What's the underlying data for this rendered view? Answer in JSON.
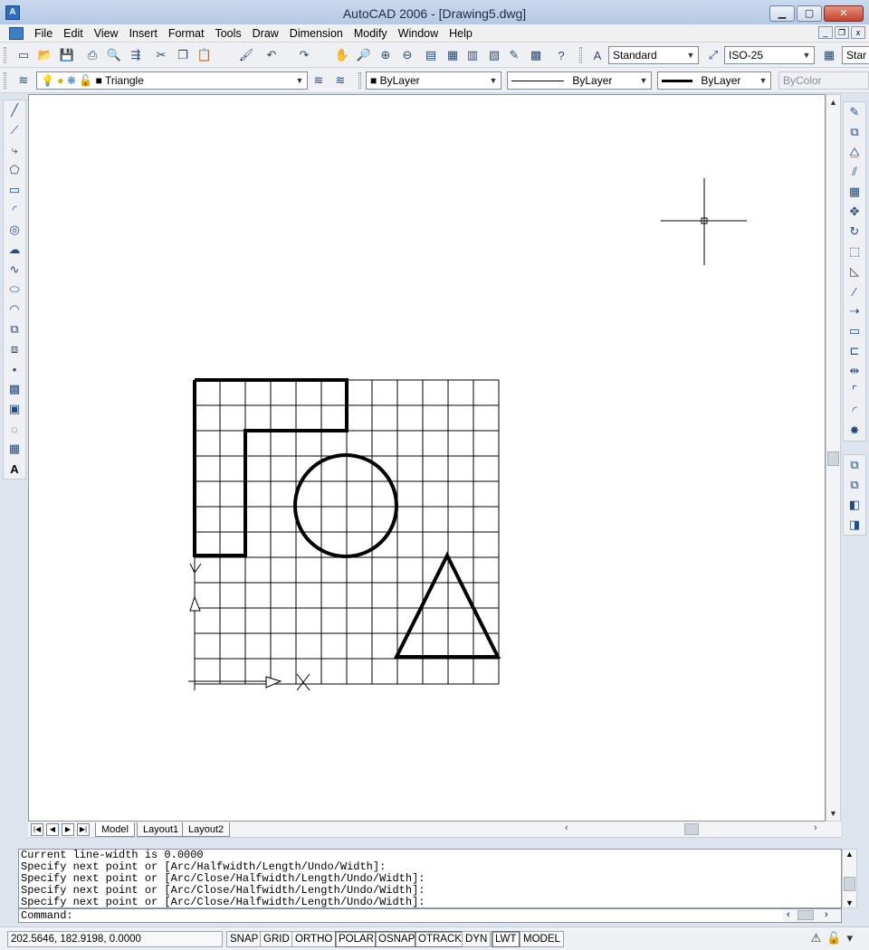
{
  "window": {
    "title": "AutoCAD 2006 - [Drawing5.dwg]",
    "app_icon": "A",
    "minimize": "▁",
    "maximize": "▢",
    "close": "✕"
  },
  "menu": {
    "items": [
      "File",
      "Edit",
      "View",
      "Insert",
      "Format",
      "Tools",
      "Draw",
      "Dimension",
      "Modify",
      "Window",
      "Help"
    ],
    "mdi_min": "_",
    "mdi_restore": "❐",
    "mdi_close": "x"
  },
  "toolbar": {
    "text_style": "Standard",
    "dim_style": "ISO-25",
    "table_style_partial": "Star",
    "layer": "Triangle",
    "color": "ByLayer",
    "linetype": "ByLayer",
    "lineweight": "ByLayer",
    "plot_style": "ByColor"
  },
  "ucs": {
    "x_label": "X",
    "y_label": "Y"
  },
  "tabs": [
    "Model",
    "Layout1",
    "Layout2"
  ],
  "nav_buttons": [
    "|◀",
    "◀",
    "▶",
    "▶|"
  ],
  "command": {
    "history": [
      "Current line-width is 0.0000",
      "Specify next point or [Arc/Halfwidth/Length/Undo/Width]:",
      "Specify next point or [Arc/Close/Halfwidth/Length/Undo/Width]:",
      "Specify next point or [Arc/Close/Halfwidth/Length/Undo/Width]:",
      "Specify next point or [Arc/Close/Halfwidth/Length/Undo/Width]:"
    ],
    "prompt": "Command:"
  },
  "status": {
    "coordinates": "202.5646, 182.9198, 0.0000",
    "buttons": [
      "SNAP",
      "GRID",
      "ORTHO",
      "POLAR",
      "OSNAP",
      "OTRACK",
      "DYN",
      "LWT",
      "MODEL"
    ],
    "active": [
      "POLAR",
      "OSNAP",
      "OTRACK",
      "LWT"
    ]
  },
  "colors": {
    "accent": "#2a6ebd",
    "drawing_bg": "#ffffff",
    "grid": "#000000"
  }
}
